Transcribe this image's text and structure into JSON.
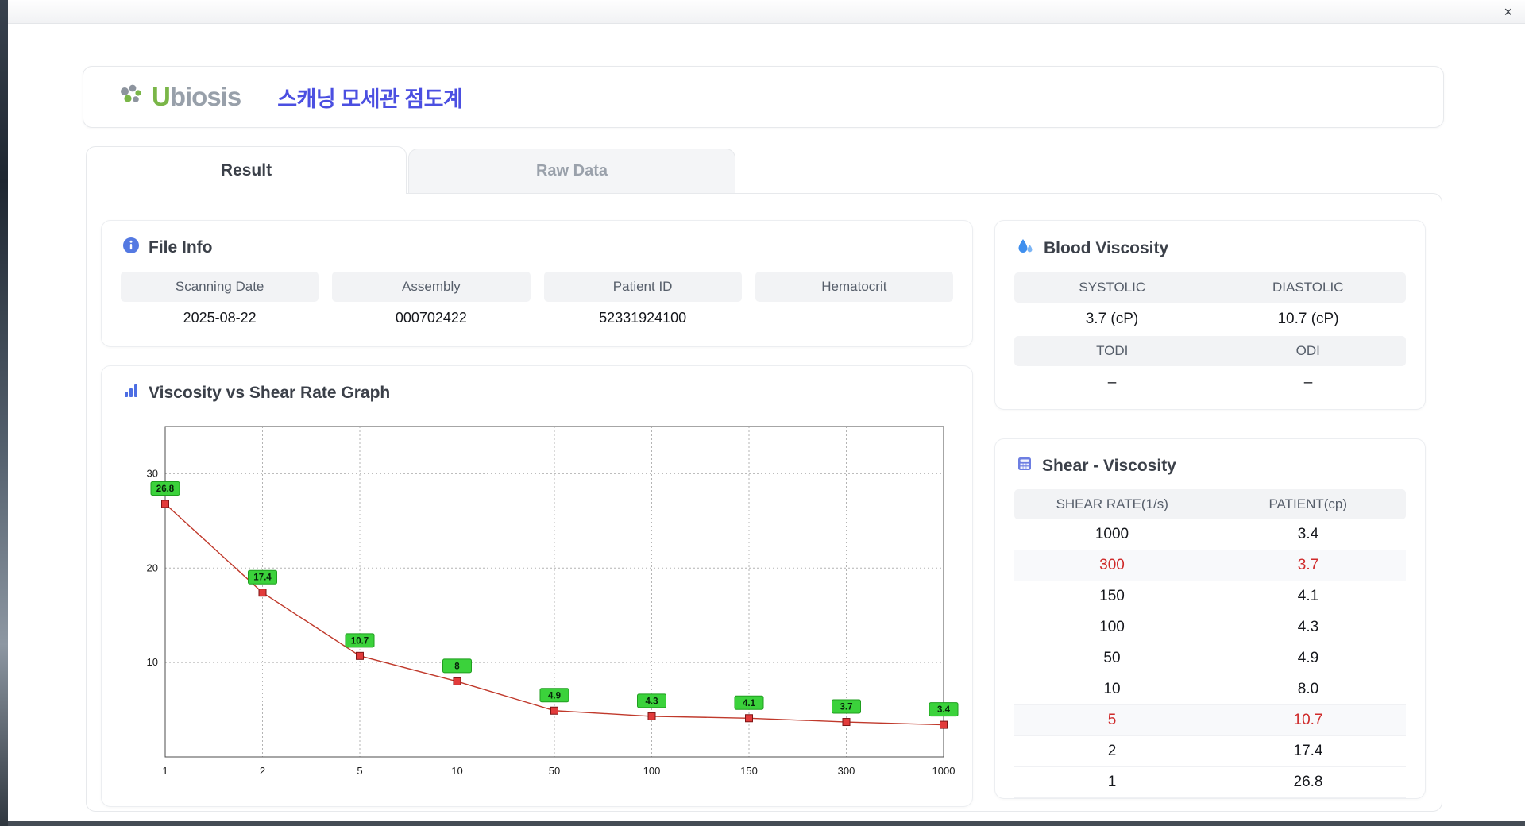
{
  "window": {
    "close_label": "×"
  },
  "header": {
    "logo": {
      "u": "U",
      "rest": "biosis"
    },
    "title": "스캐닝 모세관 점도계"
  },
  "tabs": [
    {
      "label": "Result",
      "active": true
    },
    {
      "label": "Raw Data",
      "active": false
    }
  ],
  "file_info": {
    "title": "File Info",
    "fields": [
      {
        "label": "Scanning Date",
        "value": "2025-08-22"
      },
      {
        "label": "Assembly",
        "value": "000702422"
      },
      {
        "label": "Patient ID",
        "value": "52331924100"
      },
      {
        "label": "Hematocrit",
        "value": ""
      }
    ]
  },
  "graph": {
    "title": "Viscosity vs Shear Rate Graph"
  },
  "chart_data": {
    "type": "line",
    "title": "Viscosity vs Shear Rate Graph",
    "x": [
      1,
      2,
      5,
      10,
      50,
      100,
      150,
      300,
      1000
    ],
    "values": [
      26.8,
      17.4,
      10.7,
      8,
      4.9,
      4.3,
      4.1,
      3.7,
      3.4
    ],
    "point_labels": [
      "26.8",
      "17.4",
      "10.7",
      "8",
      "4.9",
      "4.3",
      "4.1",
      "3.7",
      "3.4"
    ],
    "yticks": [
      10,
      20,
      30
    ],
    "ylim": [
      0,
      35
    ],
    "x_axis_style": "log-like categorical ticks, equally spaced",
    "grid": true,
    "line_color": "#c0392b",
    "marker_color": "#e23b3b",
    "marker_border": "#7e1515",
    "label_bg": "#3bd23b",
    "label_border": "#1f9e1f"
  },
  "blood_viscosity": {
    "title": "Blood Viscosity",
    "rows": [
      {
        "headers": [
          "SYSTOLIC",
          "DIASTOLIC"
        ],
        "values": [
          "3.7 (cP)",
          "10.7 (cP)"
        ]
      },
      {
        "headers": [
          "TODI",
          "ODI"
        ],
        "values": [
          "–",
          "–"
        ]
      }
    ]
  },
  "shear_viscosity": {
    "title": "Shear - Viscosity",
    "columns": [
      "SHEAR RATE(1/s)",
      "PATIENT(cp)"
    ],
    "rows": [
      {
        "shear": "1000",
        "patient": "3.4",
        "highlight": false
      },
      {
        "shear": "300",
        "patient": "3.7",
        "highlight": true
      },
      {
        "shear": "150",
        "patient": "4.1",
        "highlight": false
      },
      {
        "shear": "100",
        "patient": "4.3",
        "highlight": false
      },
      {
        "shear": "50",
        "patient": "4.9",
        "highlight": false
      },
      {
        "shear": "10",
        "patient": "8.0",
        "highlight": false
      },
      {
        "shear": "5",
        "patient": "10.7",
        "highlight": true
      },
      {
        "shear": "2",
        "patient": "17.4",
        "highlight": false
      },
      {
        "shear": "1",
        "patient": "26.8",
        "highlight": false
      }
    ]
  },
  "colors": {
    "accent_blue": "#4b4fe1",
    "logo_green": "#7ab648",
    "highlight_red": "#cf2a2a",
    "icon_blue": "#4d6ee3"
  }
}
